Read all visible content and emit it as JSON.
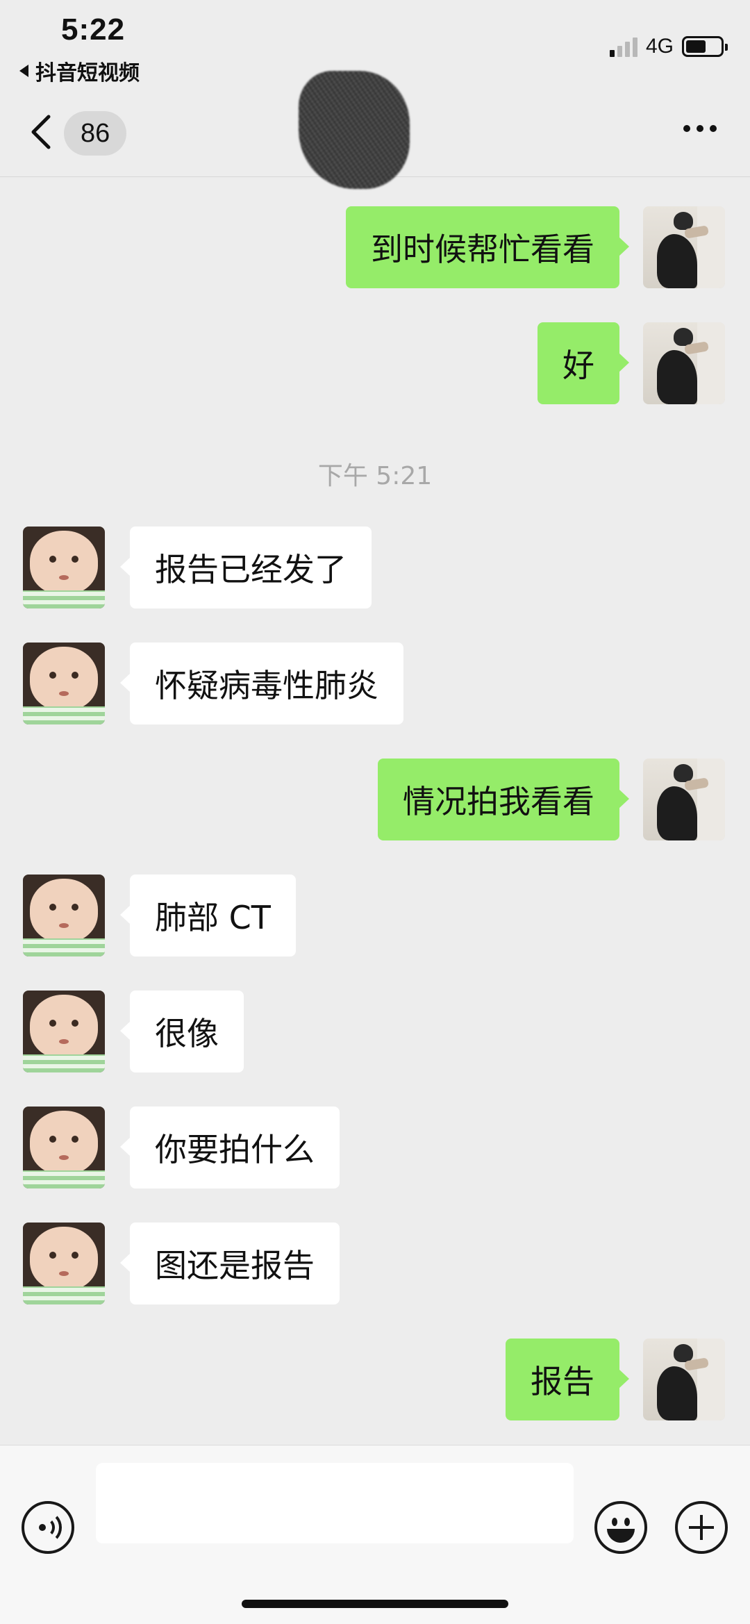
{
  "status_bar": {
    "time": "5:22",
    "back_app": "抖音短视频",
    "network": "4G",
    "signal_bars_active": 1,
    "battery_level": 0.58
  },
  "nav": {
    "unread_count": "86",
    "title": ""
  },
  "colors": {
    "background": "#ededed",
    "outgoing_bubble": "#95ec69",
    "incoming_bubble": "#ffffff",
    "timestamp_text": "#a8a8a8"
  },
  "messages": [
    {
      "side": "right",
      "text": "到时候帮忙看看",
      "avatar": "dog-avatar-icon"
    },
    {
      "side": "right",
      "text": "好",
      "avatar": "dog-avatar-icon"
    },
    {
      "side": "left",
      "text": "报告已经发了",
      "avatar": "baby-avatar-icon"
    },
    {
      "side": "left",
      "text": "怀疑病毒性肺炎",
      "avatar": "baby-avatar-icon"
    },
    {
      "side": "right",
      "text": "情况拍我看看",
      "avatar": "dog-avatar-icon"
    },
    {
      "side": "left",
      "text": "肺部 CT",
      "avatar": "baby-avatar-icon"
    },
    {
      "side": "left",
      "text": "很像",
      "avatar": "baby-avatar-icon"
    },
    {
      "side": "left",
      "text": "你要拍什么",
      "avatar": "baby-avatar-icon"
    },
    {
      "side": "left",
      "text": "图还是报告",
      "avatar": "baby-avatar-icon"
    },
    {
      "side": "right",
      "text": "报告",
      "avatar": "dog-avatar-icon"
    }
  ],
  "timestamp": "下午 5:21",
  "input": {
    "value": "",
    "placeholder": ""
  },
  "icons": {
    "voice": "voice-icon",
    "emoji": "emoji-icon",
    "plus": "plus-icon",
    "back": "chevron-left-icon",
    "more": "more-dots-icon"
  }
}
